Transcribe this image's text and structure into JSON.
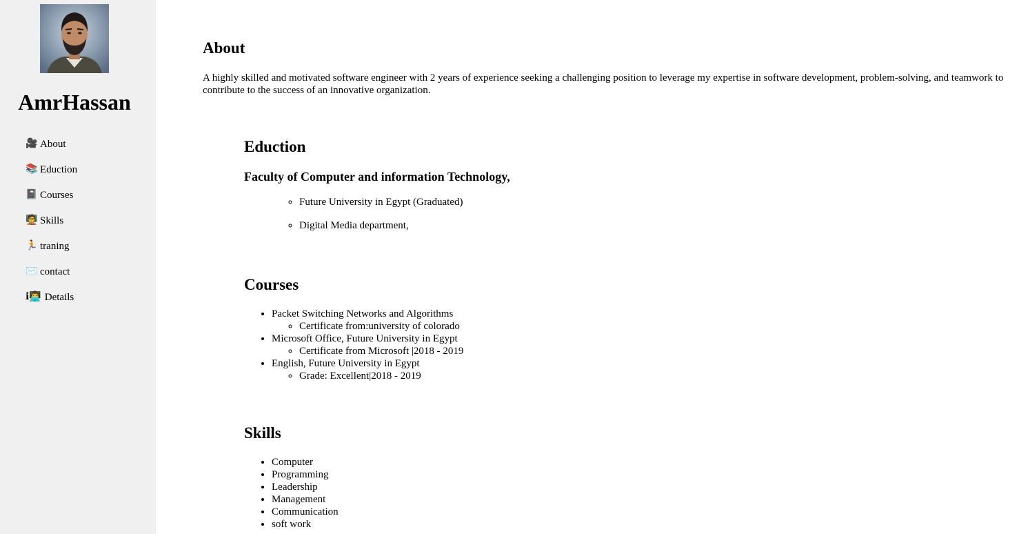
{
  "sidebar": {
    "name": "AmrHassan",
    "nav": [
      {
        "icon": "🎥",
        "icon_name": "camera-icon",
        "label": "About"
      },
      {
        "icon": "📚",
        "icon_name": "books-icon",
        "label": "Eduction"
      },
      {
        "icon": "📓",
        "icon_name": "notebook-icon",
        "label": "Courses"
      },
      {
        "icon": "🧑‍🏫",
        "icon_name": "teacher-icon",
        "label": "Skills"
      },
      {
        "icon": "🏃",
        "icon_name": "runner-icon",
        "label": "traning"
      },
      {
        "icon": "✉️",
        "icon_name": "envelope-icon",
        "label": "contact"
      },
      {
        "icon": "ℹ👨‍💻",
        "icon_name": "info-person-icon",
        "label": "Details"
      }
    ]
  },
  "about": {
    "title": "About",
    "text": "A highly skilled and motivated software engineer with 2 years of experience seeking a challenging position to leverage my expertise in software development, problem-solving, and teamwork to contribute to the success of an innovative organization."
  },
  "education": {
    "title": "Eduction",
    "faculty": "Faculty of Computer and information Technology,",
    "items": [
      "Future University in Egypt (Graduated)",
      "Digital Media department,"
    ]
  },
  "courses": {
    "title": "Courses",
    "items": [
      {
        "name": "Packet Switching Networks and Algorithms",
        "detail": "Certificate from:university of colorado"
      },
      {
        "name": "Microsoft Office, Future University in Egypt",
        "detail": "Certificate from Microsoft |2018 - 2019"
      },
      {
        "name": "English, Future University in Egypt",
        "detail": "Grade: Excellent|2018 - 2019"
      }
    ]
  },
  "skills": {
    "title": "Skills",
    "items": [
      "Computer",
      "Programming",
      "Leadership",
      "Management",
      "Communication",
      "soft work"
    ]
  },
  "colors": {
    "sidebar_bg": "#f0f0f0",
    "page_bg": "#ffffff"
  }
}
